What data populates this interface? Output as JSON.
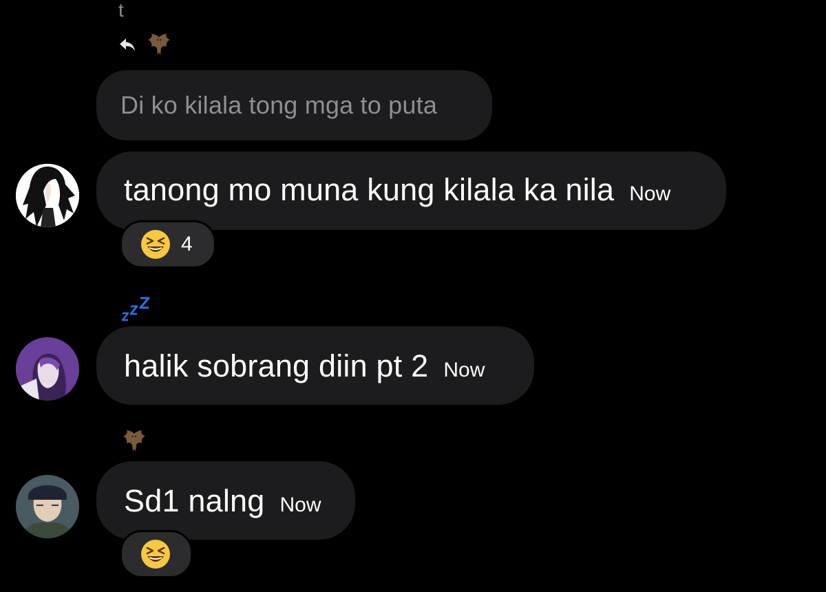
{
  "thread": {
    "sender_initial": "t",
    "quoted_message": "Di ko kilala tong mga to puta",
    "messages": [
      {
        "text": "tanong mo muna kung kilala ka nila",
        "time": "Now",
        "avatar": "avatar-black-hair-character",
        "reaction": {
          "emoji": "laughing-squint-emoji",
          "count": "4"
        }
      },
      {
        "status_icon": "zzz-sleep-icon",
        "text": "halik sobrang diin pt 2",
        "time": "Now",
        "avatar": "avatar-purple-hair-character"
      },
      {
        "status_icon": "bat-icon",
        "text": "Sd1 nalng",
        "time": "Now",
        "avatar": "avatar-beanie-character",
        "reaction": {
          "emoji": "laughing-squint-emoji",
          "count": ""
        }
      }
    ]
  },
  "colors": {
    "background": "#000000",
    "bubble": "#1c1c1e",
    "quoted_text": "#8e8e93",
    "reaction_pill": "#2c2c2e",
    "zzz_blue": "#2f6fe0"
  }
}
